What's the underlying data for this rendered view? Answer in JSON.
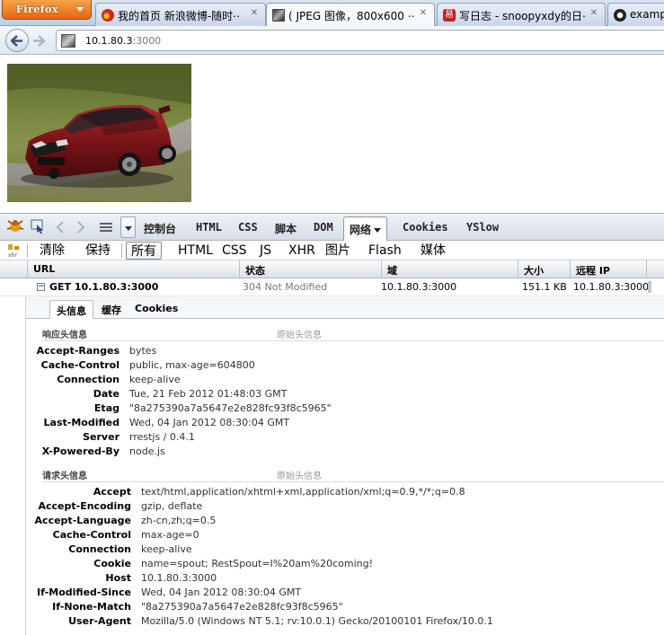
{
  "browser": {
    "app_button": "Firefox",
    "tabs": [
      {
        "title": "我的首页 新浪微博-随时⋯",
        "icon": "weibo-icon",
        "color": "#d6261f"
      },
      {
        "title": "( JPEG 图像，800x600 ⋯",
        "icon": "image-icon",
        "color": "#555555",
        "active": true
      },
      {
        "title": "写日志 - snoopyxdy的日⋯",
        "icon": "netease-blog-icon",
        "color": "#cc1d1d"
      },
      {
        "title": "example",
        "icon": "github-icon",
        "color": "#222222"
      }
    ],
    "address": {
      "host": "10.1.80.3",
      "port": ":3000"
    }
  },
  "firebug": {
    "panels": [
      "控制台",
      "HTML",
      "CSS",
      "脚本",
      "DOM",
      "网络",
      "Cookies",
      "YSlow"
    ],
    "active_panel": "网络",
    "net_buttons": [
      "清除",
      "保持",
      "所有",
      "HTML",
      "CSS",
      "JS",
      "XHR",
      "图片",
      "Flash",
      "媒体"
    ],
    "active_net_button": "所有",
    "columns": [
      "URL",
      "状态",
      "域",
      "大小",
      "远程 IP"
    ],
    "request": {
      "toggle": "−",
      "url": "GET 10.1.80.3:3000",
      "status": "304 Not Modified",
      "domain": "10.1.80.3:3000",
      "size": "151.1 KB",
      "remote_ip": "10.1.80.3:3000"
    },
    "detail_tabs": [
      "头信息",
      "缓存",
      "Cookies"
    ],
    "response_headers_title": "响应头信息",
    "request_headers_title": "请求头信息",
    "raw_headers_link": "原始头信息",
    "response_headers": [
      {
        "name": "Accept-Ranges",
        "value": "bytes"
      },
      {
        "name": "Cache-Control",
        "value": "public, max-age=604800"
      },
      {
        "name": "Connection",
        "value": "keep-alive"
      },
      {
        "name": "Date",
        "value": "Tue, 21 Feb 2012 01:48:03 GMT"
      },
      {
        "name": "Etag",
        "value": "\"8a275390a7a5647e2e828fc93f8c5965\""
      },
      {
        "name": "Last-Modified",
        "value": "Wed, 04 Jan 2012 08:30:04 GMT"
      },
      {
        "name": "Server",
        "value": "rrestjs / 0.4.1"
      },
      {
        "name": "X-Powered-By",
        "value": "node.js"
      }
    ],
    "request_headers": [
      {
        "name": "Accept",
        "value": "text/html,application/xhtml+xml,application/xml;q=0.9,*/*;q=0.8"
      },
      {
        "name": "Accept-Encoding",
        "value": "gzip, deflate"
      },
      {
        "name": "Accept-Language",
        "value": "zh-cn,zh;q=0.5"
      },
      {
        "name": "Cache-Control",
        "value": "max-age=0"
      },
      {
        "name": "Connection",
        "value": "keep-alive"
      },
      {
        "name": "Cookie",
        "value": "name=spout; RestSpout=I%20am%20coming!"
      },
      {
        "name": "Host",
        "value": "10.1.80.3:3000"
      },
      {
        "name": "If-Modified-Since",
        "value": "Wed, 04 Jan 2012 08:30:04 GMT"
      },
      {
        "name": "If-None-Match",
        "value": "\"8a275390a7a5647e2e828fc93f8c5965\""
      },
      {
        "name": "User-Agent",
        "value": "Mozilla/5.0 (Windows NT 5.1; rv:10.0.1) Gecko/20100101 Firefox/10.0.1"
      }
    ]
  }
}
